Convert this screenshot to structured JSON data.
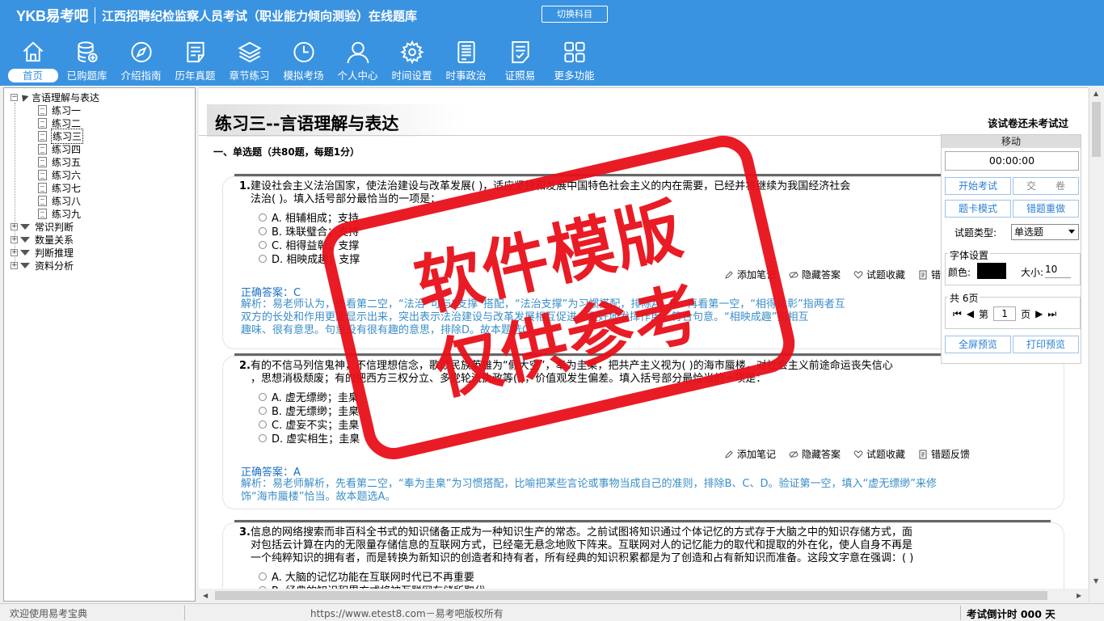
{
  "header": {
    "brand": "YKB易考吧",
    "title": "江西招聘纪检监察人员考试（职业能力倾向测验）在线题库",
    "switch_label": "切换科目",
    "nav": [
      {
        "label": "首页",
        "icon": "home-icon"
      },
      {
        "label": "已购题库",
        "icon": "database-icon"
      },
      {
        "label": "介绍指南",
        "icon": "compass-icon"
      },
      {
        "label": "历年真题",
        "icon": "document-list-icon"
      },
      {
        "label": "章节练习",
        "icon": "layers-icon"
      },
      {
        "label": "模拟考场",
        "icon": "clock-icon"
      },
      {
        "label": "个人中心",
        "icon": "user-icon"
      },
      {
        "label": "时间设置",
        "icon": "gear-icon"
      },
      {
        "label": "时事政治",
        "icon": "newspaper-icon"
      },
      {
        "label": "证照易",
        "icon": "checklist-icon"
      },
      {
        "label": "更多功能",
        "icon": "grid-icon"
      }
    ]
  },
  "tree": {
    "root": "言语理解与表达",
    "items": [
      "练习一",
      "练习二",
      "练习三",
      "练习四",
      "练习五",
      "练习六",
      "练习七",
      "练习八",
      "练习九"
    ],
    "selected": "练习三",
    "categories": [
      "常识判断",
      "数量关系",
      "判断推理",
      "资料分析"
    ]
  },
  "paper": {
    "title": "练习三--言语理解与表达",
    "status": "该试卷还未考试过",
    "section": "一、单选题（共80题，每题1分）"
  },
  "questions": [
    {
      "num": "1.",
      "line1": "建设社会主义法治国家，使法治建设与改革发展( )，适应坚持和发展中国特色社会主义的内在需要，已经并将继续为我国经济社会",
      "line2": "法治( )。填入括号部分最恰当的一项是：",
      "options": [
        "A. 相辅相成；支持",
        "B. 珠联璧合；支持",
        "C. 相得益彰；支撑",
        "D. 相映成趣；支撑"
      ],
      "answer": "正确答案：C",
      "analysis1": "解析：易老师认为，先看第二空，“法治”可与“支撑”搭配，“法治支撑”为习惯搭配，排除A、B。再看第一空，“相得益彰”指两者互",
      "analysis2": "双方的长处和作用更能显示出来，突出表示法治建设与改革发展相互促进，更好地发挥作用，符合句意。“相映成趣”指相互",
      "analysis3": "趣味、很有意思。句意没有很有趣的意思，排除D。故本题选C。"
    },
    {
      "num": "2.",
      "line1": "有的不信马列信鬼神，不信理想信念，歌颂民族英雄为“假大空”，奉为圭臬，把共产主义视为( )的海市蜃楼，对社会主义前途命运丧失信心",
      "line2": "，思想消极颓废；有的把西方三权分立、多党轮流执政等( )，价值观发生偏差。填入括号部分最恰当的一项是：",
      "options": [
        "A. 虚无缥缈；圭臬",
        "B. 虚无缥缈；圭臬",
        "C. 虚妄不实；圭臬",
        "D. 虚实相生；圭臬"
      ],
      "answer": "正确答案：A",
      "analysis1": "解析：易老师解析，先看第二空，“奉为圭臬”为习惯搭配，比喻把某些言论或事物当成自己的准则，排除B、C、D。验证第一空，填入“虚无缥缈”来修",
      "analysis2": "饰“海市蜃楼”恰当。故本题选A。"
    },
    {
      "num": "3.",
      "line1": "信息的网络搜索而非百科全书式的知识储备正成为一种知识生产的常态。之前试图将知识通过个体记忆的方式存于大脑之中的知识存储方式，面",
      "line2": "对包括云计算在内的无限量存储信息的互联网方式，已经毫无悬念地败下阵来。互联网对人的记忆能力的取代和提取的外在化，使人自身不再是",
      "line3": "一个纯粹知识的拥有者，而是转换为新知识的创造者和持有者，所有经典的知识积累都是为了创造和占有新知识而准备。这段文字意在强调：( )",
      "options": [
        "A. 大脑的记忆功能在互联网时代已不再重要",
        "B. 经典的知识积累方式将被互联网存储所取代"
      ]
    }
  ],
  "actions": {
    "note": "添加笔记",
    "hide": "隐藏答案",
    "fav": "试题收藏",
    "feedback": "错题反馈"
  },
  "panel": {
    "title": "移动",
    "timer": "00:00:00",
    "start": "开始考试",
    "submit": "交　　卷",
    "card_mode": "题卡模式",
    "redo": "错题重做",
    "type_label": "试题类型:",
    "type_value": "单选题",
    "font_legend": "字体设置",
    "color_label": "颜色:",
    "size_label": "大小:",
    "size_value": "10",
    "pages": "共 6页",
    "page_prefix": "第",
    "page_value": "1",
    "page_suffix": "页",
    "fullscreen": "全屏预览",
    "print": "打印预览",
    "font_color": "#000000"
  },
  "status": {
    "welcome": "欢迎使用易考宝典",
    "url": "https://www.etest8.com－易考吧版权所有",
    "countdown": "考试倒计时 000 天"
  },
  "watermark": {
    "line1": "软件模版",
    "line2": "仅供参考",
    "color": "#e8101a"
  }
}
